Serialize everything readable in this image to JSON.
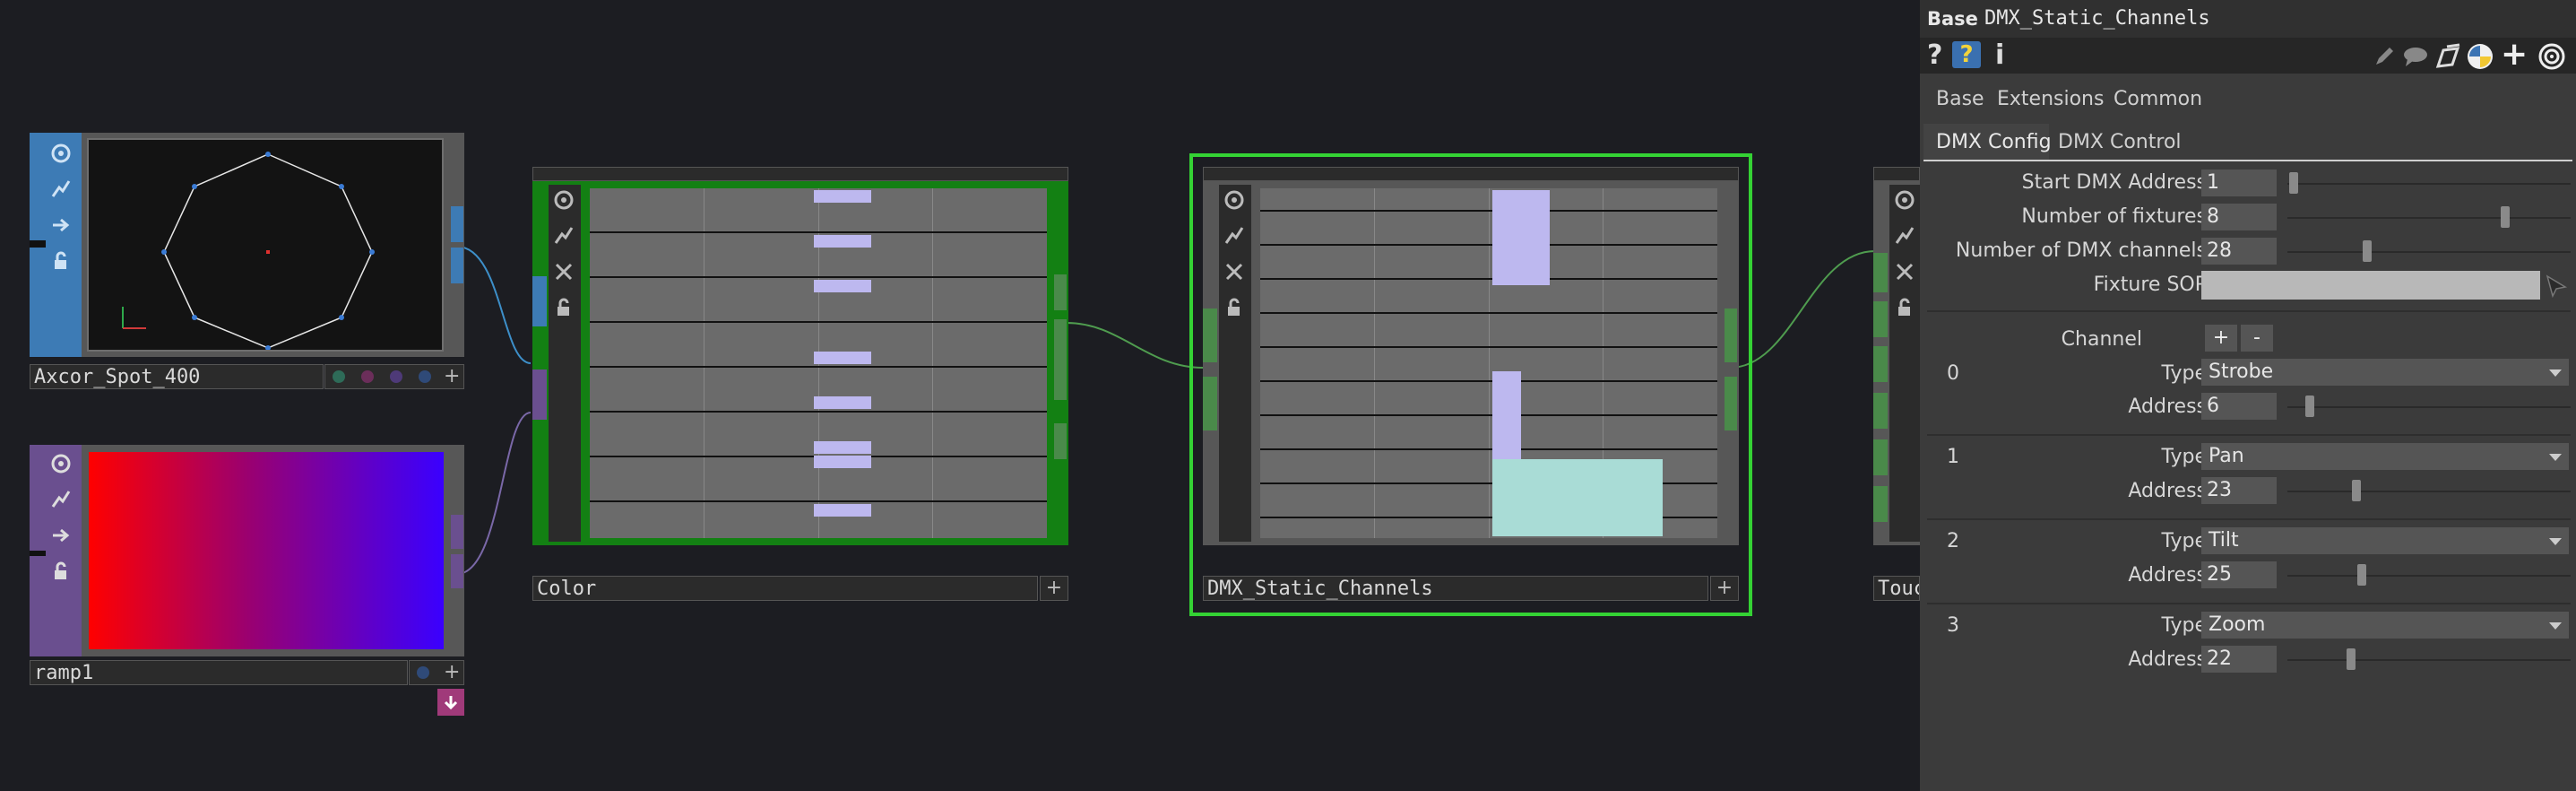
{
  "nodes": {
    "axcor": {
      "label": "Axcor_Spot_400"
    },
    "ramp": {
      "label": "ramp1"
    },
    "color": {
      "label": "Color"
    },
    "dmx": {
      "label": "DMX_Static_Channels"
    },
    "touch": {
      "label": "Touc"
    }
  },
  "panel": {
    "op_type": "Base",
    "op_name": "DMX_Static_Channels",
    "toolbar_icons": [
      "help-icon",
      "python-help-icon",
      "info-icon",
      "edit-icon",
      "comment-icon",
      "clone-icon",
      "python-icon",
      "add-icon",
      "target-icon"
    ],
    "page_tabs": [
      "Base",
      "Extensions",
      "Common"
    ],
    "sub_tabs": [
      "DMX Config",
      "DMX Control"
    ],
    "params": {
      "start_label": "Start DMX Address",
      "start_value": "1",
      "fixtures_label": "Number of fixtures",
      "fixtures_value": "8",
      "channels_label": "Number of DMX channels",
      "channels_value": "28",
      "sop_label": "Fixture SOP",
      "sop_value": ""
    },
    "channel_header": {
      "label": "Channel",
      "add": "+",
      "remove": "-"
    },
    "type_label": "Type",
    "address_label": "Address",
    "channels": [
      {
        "index": "0",
        "type": "Strobe",
        "address": "6"
      },
      {
        "index": "1",
        "type": "Pan",
        "address": "23"
      },
      {
        "index": "2",
        "type": "Tilt",
        "address": "25"
      },
      {
        "index": "3",
        "type": "Zoom",
        "address": "22"
      }
    ]
  },
  "colors": {
    "background": "#1c1d22",
    "sop_blue": "#3d7bb5",
    "top_purple": "#6a4f8f",
    "chop_green": "#138013",
    "selection_green": "#34d234",
    "channel_bar": "#bdb8ef",
    "channel_bar_alt": "#a9dcd6"
  }
}
